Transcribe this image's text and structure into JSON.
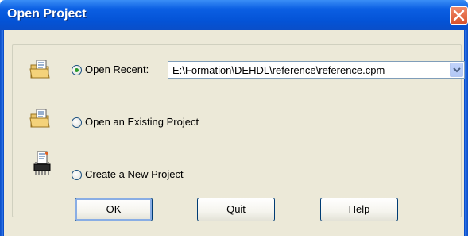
{
  "window": {
    "title": "Open Project"
  },
  "options": [
    {
      "label": "Open Recent:",
      "selected": true,
      "icon": "folder-document-icon"
    },
    {
      "label": "Open an Existing Project",
      "selected": false,
      "icon": "folder-document-icon"
    },
    {
      "label": "Create a New Project",
      "selected": false,
      "icon": "chip-document-icon"
    }
  ],
  "recent_combo": {
    "value": "E:\\Formation\\DEHDL\\reference\\reference.cpm"
  },
  "buttons": {
    "ok": "OK",
    "quit": "Quit",
    "help": "Help"
  }
}
